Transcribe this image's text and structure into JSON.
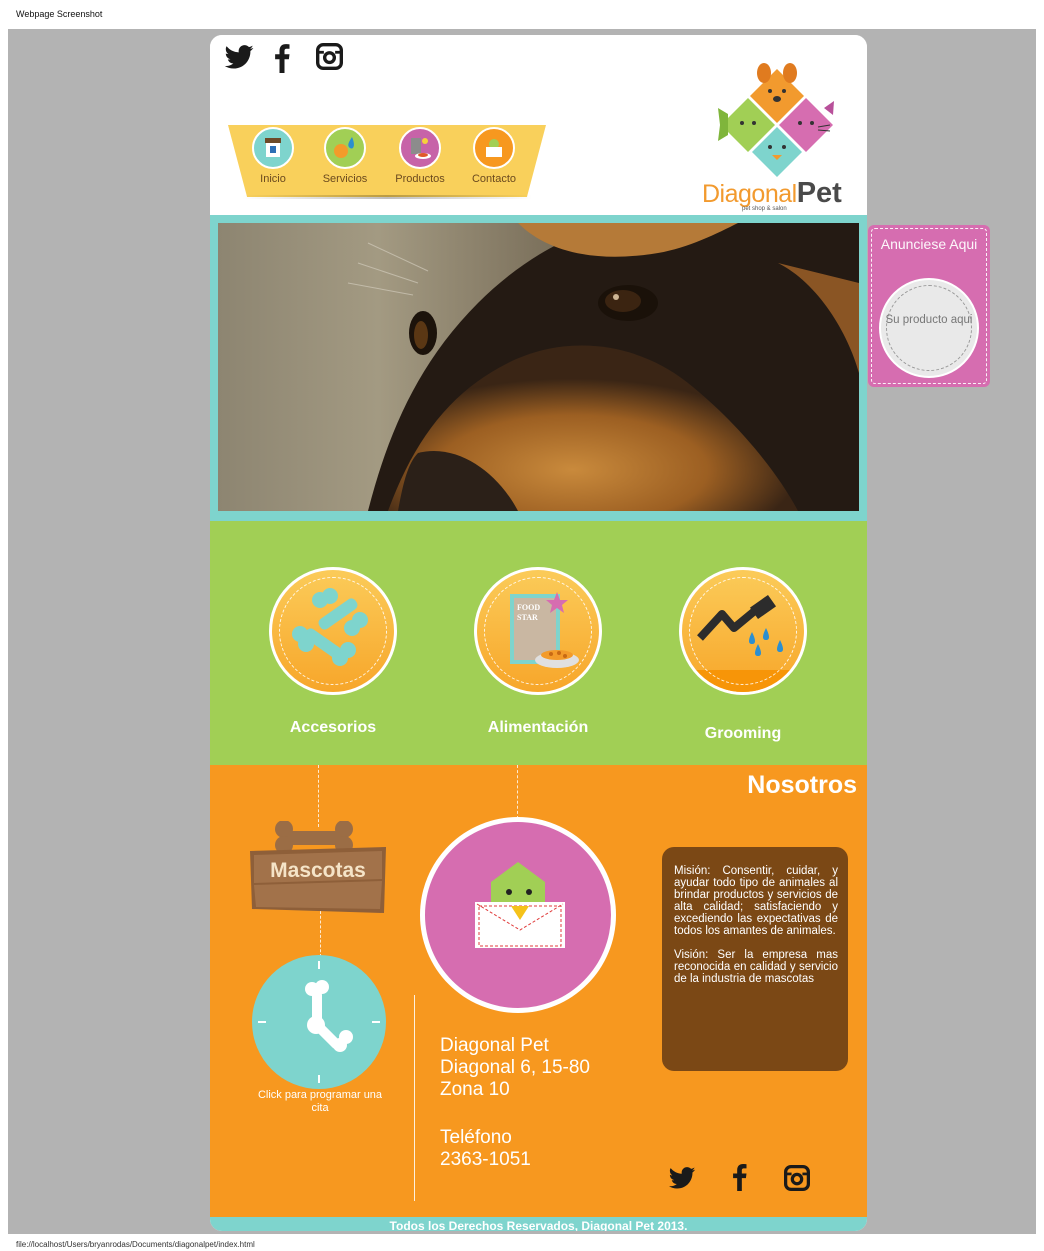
{
  "capture": {
    "top_caption": "Webpage Screenshot",
    "bottom_caption": "file://localhost/Users/bryanrodas/Documents/diagonalpet/index.html"
  },
  "colors": {
    "viewport_bg": "#b3b3b3",
    "teal": "#7ed4cd",
    "green": "#a1cf55",
    "orange": "#f7981f",
    "pink": "#d66db0",
    "yellow": "#f9d05b",
    "brown": "#7b4815"
  },
  "header": {
    "social_icons": [
      "twitter-icon",
      "facebook-icon",
      "instagram-icon"
    ],
    "nav": [
      {
        "label": "Inicio",
        "icon": "store-icon",
        "color": "#7ed4cd"
      },
      {
        "label": "Servicios",
        "icon": "water-drop-icon",
        "color": "#a1cf55"
      },
      {
        "label": "Productos",
        "icon": "products-icon",
        "color": "#c763a8"
      },
      {
        "label": "Contacto",
        "icon": "mail-icon",
        "color": "#f7981f"
      }
    ],
    "logo": {
      "word1": "Diagonal",
      "word2": "Pet",
      "tagline": "pet shop & salon"
    }
  },
  "hero": {
    "image": "dog-closeup-photo"
  },
  "ad": {
    "title": "Anunciese Aqui",
    "circle_text": "Su producto aqui"
  },
  "services": [
    {
      "label": "Accesorios",
      "icon": "bones-icon"
    },
    {
      "label": "Alimentación",
      "icon": "food-bag-icon",
      "bag_text": "FOOD STAR"
    },
    {
      "label": "Grooming",
      "icon": "grooming-icon"
    }
  ],
  "about": {
    "title": "Nosotros",
    "sign_label": "Mascotas",
    "clock_caption": "Click para programar una cita",
    "address": [
      "Diagonal Pet",
      "Diagonal 6, 15-80",
      "Zona 10"
    ],
    "phone": [
      "Teléfono",
      "2363-1051"
    ],
    "mission": "Misión: Consentir, cuidar, y ayudar todo tipo de animales al brindar productos y servicios de alta calidad; satisfaciendo y excediendo las expectativas de todos los amantes de animales.",
    "vision": "Visión: Ser la empresa mas reconocida en calidad y servicio de la industria de mascotas",
    "social_icons": [
      "twitter-icon",
      "facebook-icon",
      "instagram-icon"
    ]
  },
  "footer": {
    "text": "Todos los Derechos Reservados, Diagonal Pet 2013."
  }
}
